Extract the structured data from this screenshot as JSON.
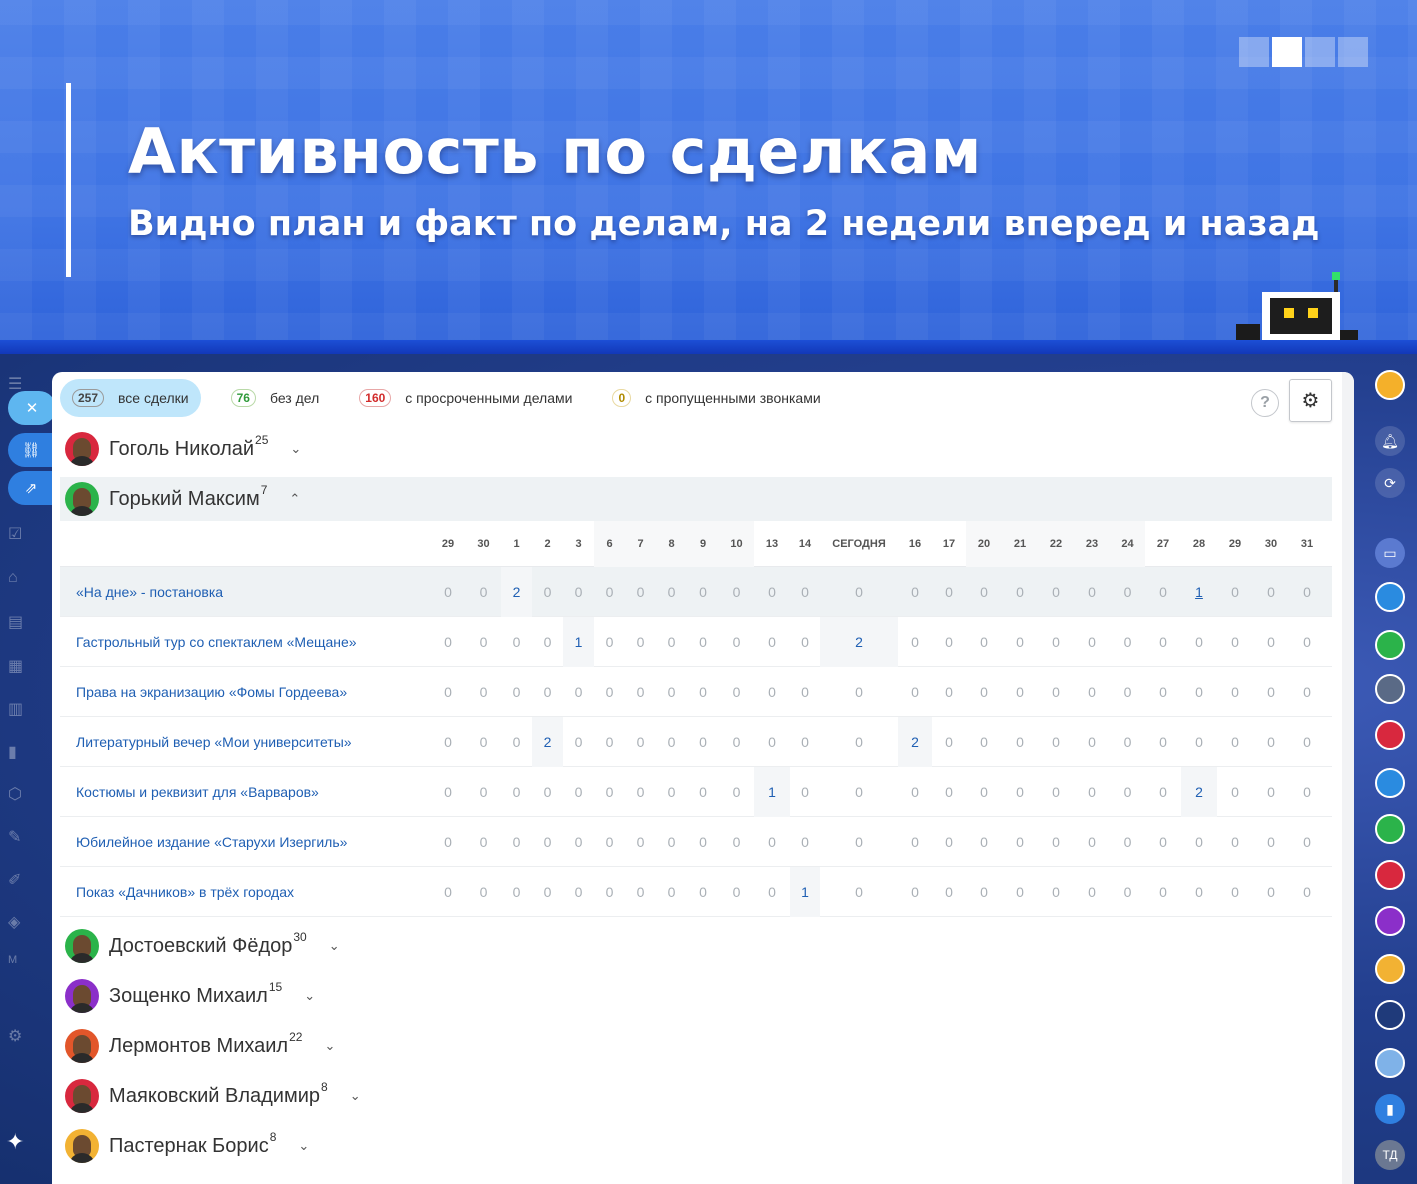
{
  "banner": {
    "title": "Активность по сделкам",
    "subtitle": "Видно план и факт по делам, на 2 недели вперед и назад"
  },
  "filters": [
    {
      "count": "257",
      "label": "все сделки",
      "color": "grey",
      "active": true
    },
    {
      "count": "76",
      "label": "без дел",
      "color": "green",
      "active": false
    },
    {
      "count": "160",
      "label": "с просроченными делами",
      "color": "red",
      "active": false
    },
    {
      "count": "0",
      "label": "с пропущенными звонками",
      "color": "yellow",
      "active": false
    }
  ],
  "toolbar": {
    "help_label": "?"
  },
  "colors": {
    "accent": "#1f5fb3",
    "active_filter": "#bfe6fb",
    "banner": "#3f74e4"
  },
  "persons_top": [
    {
      "name": "Гоголь Николай",
      "count": "25",
      "open": false,
      "avatar_bg": "#d8283e"
    },
    {
      "name": "Горький Максим",
      "count": "7",
      "open": true,
      "avatar_bg": "#2bb34a"
    }
  ],
  "persons_bottom": [
    {
      "name": "Достоевский Фёдор",
      "count": "30",
      "avatar_bg": "#2bb34a"
    },
    {
      "name": "Зощенко Михаил",
      "count": "15",
      "avatar_bg": "#8b2fc9"
    },
    {
      "name": "Лермонтов Михаил",
      "count": "22",
      "avatar_bg": "#e2562a"
    },
    {
      "name": "Маяковский Владимир",
      "count": "8",
      "avatar_bg": "#d8283e"
    },
    {
      "name": "Пастернак Борис",
      "count": "8",
      "avatar_bg": "#f2b233"
    }
  ],
  "table": {
    "days": [
      "29",
      "30",
      "1",
      "2",
      "3",
      "6",
      "7",
      "8",
      "9",
      "10",
      "13",
      "14",
      "СЕГОДНЯ",
      "16",
      "17",
      "20",
      "21",
      "22",
      "23",
      "24",
      "27",
      "28",
      "29",
      "30",
      "31"
    ],
    "rows": [
      {
        "name": "«На дне» - постановка",
        "values": [
          "0",
          "0",
          "2",
          "0",
          "0",
          "0",
          "0",
          "0",
          "0",
          "0",
          "0",
          "0",
          "0",
          "0",
          "0",
          "0",
          "0",
          "0",
          "0",
          "0",
          "0",
          "1",
          "0",
          "0",
          "0"
        ]
      },
      {
        "name": "Гастрольный тур со спектаклем «Мещане»",
        "values": [
          "0",
          "0",
          "0",
          "0",
          "1",
          "0",
          "0",
          "0",
          "0",
          "0",
          "0",
          "0",
          "2",
          "0",
          "0",
          "0",
          "0",
          "0",
          "0",
          "0",
          "0",
          "0",
          "0",
          "0",
          "0"
        ]
      },
      {
        "name": "Права на экранизацию «Фомы Гордеева»",
        "values": [
          "0",
          "0",
          "0",
          "0",
          "0",
          "0",
          "0",
          "0",
          "0",
          "0",
          "0",
          "0",
          "0",
          "0",
          "0",
          "0",
          "0",
          "0",
          "0",
          "0",
          "0",
          "0",
          "0",
          "0",
          "0"
        ]
      },
      {
        "name": "Литературный вечер «Мои университеты»",
        "values": [
          "0",
          "0",
          "0",
          "2",
          "0",
          "0",
          "0",
          "0",
          "0",
          "0",
          "0",
          "0",
          "0",
          "2",
          "0",
          "0",
          "0",
          "0",
          "0",
          "0",
          "0",
          "0",
          "0",
          "0",
          "0"
        ]
      },
      {
        "name": "Костюмы и реквизит для «Варваров»",
        "values": [
          "0",
          "0",
          "0",
          "0",
          "0",
          "0",
          "0",
          "0",
          "0",
          "0",
          "1",
          "0",
          "0",
          "0",
          "0",
          "0",
          "0",
          "0",
          "0",
          "0",
          "0",
          "2",
          "0",
          "0",
          "0"
        ]
      },
      {
        "name": "Юбилейное издание «Старухи Изергиль»",
        "values": [
          "0",
          "0",
          "0",
          "0",
          "0",
          "0",
          "0",
          "0",
          "0",
          "0",
          "0",
          "0",
          "0",
          "0",
          "0",
          "0",
          "0",
          "0",
          "0",
          "0",
          "0",
          "0",
          "0",
          "0",
          "0"
        ]
      },
      {
        "name": "Показ «Дачников» в трёх городах",
        "values": [
          "0",
          "0",
          "0",
          "0",
          "0",
          "0",
          "0",
          "0",
          "0",
          "0",
          "0",
          "1",
          "0",
          "0",
          "0",
          "0",
          "0",
          "0",
          "0",
          "0",
          "0",
          "0",
          "0",
          "0",
          "0"
        ]
      }
    ]
  },
  "right_rail": {
    "user_initials": "ТД"
  }
}
